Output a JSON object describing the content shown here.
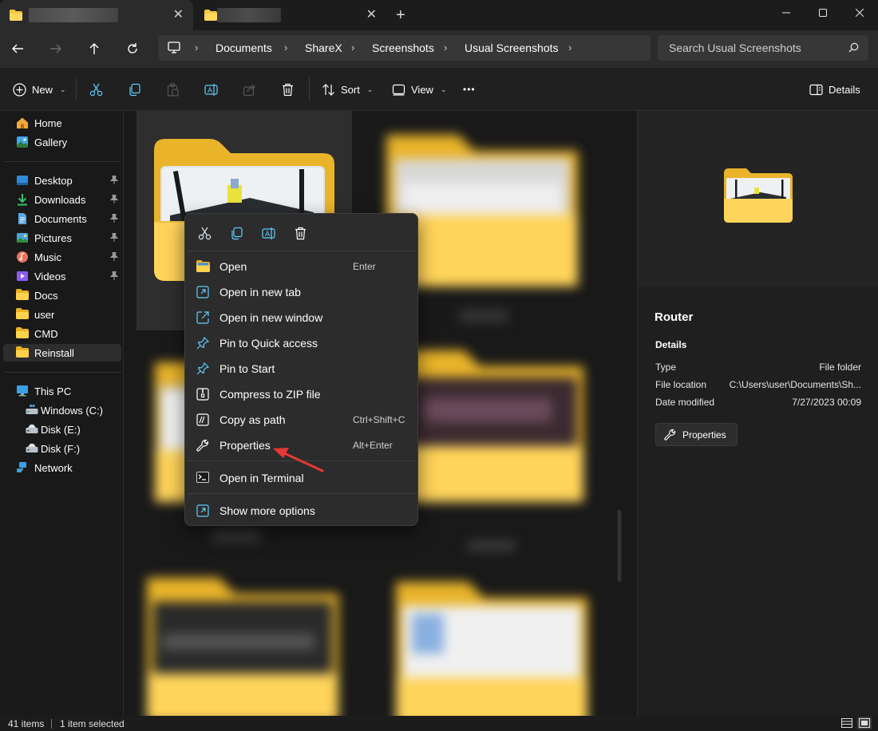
{
  "tabs": [
    {
      "title": "",
      "close": "✕"
    },
    {
      "title": "",
      "close": "✕"
    }
  ],
  "new_tab": "+",
  "breadcrumb": [
    "Documents",
    "ShareX",
    "Screenshots",
    "Usual Screenshots"
  ],
  "search": {
    "placeholder": "Search Usual Screenshots"
  },
  "commandbar": {
    "new_label": "New",
    "sort_label": "Sort",
    "view_label": "View",
    "more_label": "•••",
    "details_label": "Details"
  },
  "sidebar": {
    "quick": [
      {
        "label": "Home",
        "icon": "home-icon"
      },
      {
        "label": "Gallery",
        "icon": "gallery-icon"
      }
    ],
    "pinned": [
      {
        "label": "Desktop",
        "icon": "desktop-icon",
        "pinned": true
      },
      {
        "label": "Downloads",
        "icon": "downloads-icon",
        "pinned": true
      },
      {
        "label": "Documents",
        "icon": "documents-icon",
        "pinned": true
      },
      {
        "label": "Pictures",
        "icon": "pictures-icon",
        "pinned": true
      },
      {
        "label": "Music",
        "icon": "music-icon",
        "pinned": true
      },
      {
        "label": "Videos",
        "icon": "videos-icon",
        "pinned": true
      },
      {
        "label": "Docs",
        "icon": "folder-icon"
      },
      {
        "label": "user",
        "icon": "folder-icon"
      },
      {
        "label": "CMD",
        "icon": "folder-icon"
      },
      {
        "label": "Reinstall",
        "icon": "folder-icon",
        "selected": true
      }
    ],
    "devices": [
      {
        "label": "This PC",
        "icon": "this-pc-icon"
      },
      {
        "label": "Windows (C:)",
        "icon": "drive-icon"
      },
      {
        "label": "Disk (E:)",
        "icon": "drive-icon"
      },
      {
        "label": "Disk (F:)",
        "icon": "drive-icon"
      },
      {
        "label": "Network",
        "icon": "network-icon"
      }
    ]
  },
  "context_menu": {
    "quick_actions": [
      "cut-icon",
      "copy-icon",
      "rename-icon",
      "delete-icon"
    ],
    "items": [
      {
        "label": "Open",
        "shortcut": "Enter",
        "icon": "folder-open-icon"
      },
      {
        "label": "Open in new tab",
        "shortcut": "",
        "icon": "open-new-tab-icon"
      },
      {
        "label": "Open in new window",
        "shortcut": "",
        "icon": "open-new-window-icon"
      },
      {
        "label": "Pin to Quick access",
        "shortcut": "",
        "icon": "pin-icon"
      },
      {
        "label": "Pin to Start",
        "shortcut": "",
        "icon": "pin-icon"
      },
      {
        "label": "Compress to ZIP file",
        "shortcut": "",
        "icon": "zip-icon"
      },
      {
        "label": "Copy as path",
        "shortcut": "Ctrl+Shift+C",
        "icon": "copy-path-icon"
      },
      {
        "label": "Properties",
        "shortcut": "Alt+Enter",
        "icon": "wrench-icon"
      },
      {
        "label": "Open in Terminal",
        "shortcut": "",
        "icon": "terminal-icon"
      },
      {
        "label": "Show more options",
        "shortcut": "",
        "icon": "show-more-icon"
      }
    ]
  },
  "details": {
    "name": "Router",
    "section": "Details",
    "rows": [
      {
        "key": "Type",
        "value": "File folder"
      },
      {
        "key": "File location",
        "value": "C:\\Users\\user\\Documents\\Sh..."
      },
      {
        "key": "Date modified",
        "value": "7/27/2023 00:09"
      }
    ],
    "properties_button": "Properties"
  },
  "status": {
    "item_count": "41 items",
    "selected": "1 item selected"
  },
  "colors": {
    "background": "#191919",
    "folder_yellow": "#f4c430",
    "accent_blue": "#4cc2ff",
    "annotation_arrow": "#e53935"
  }
}
